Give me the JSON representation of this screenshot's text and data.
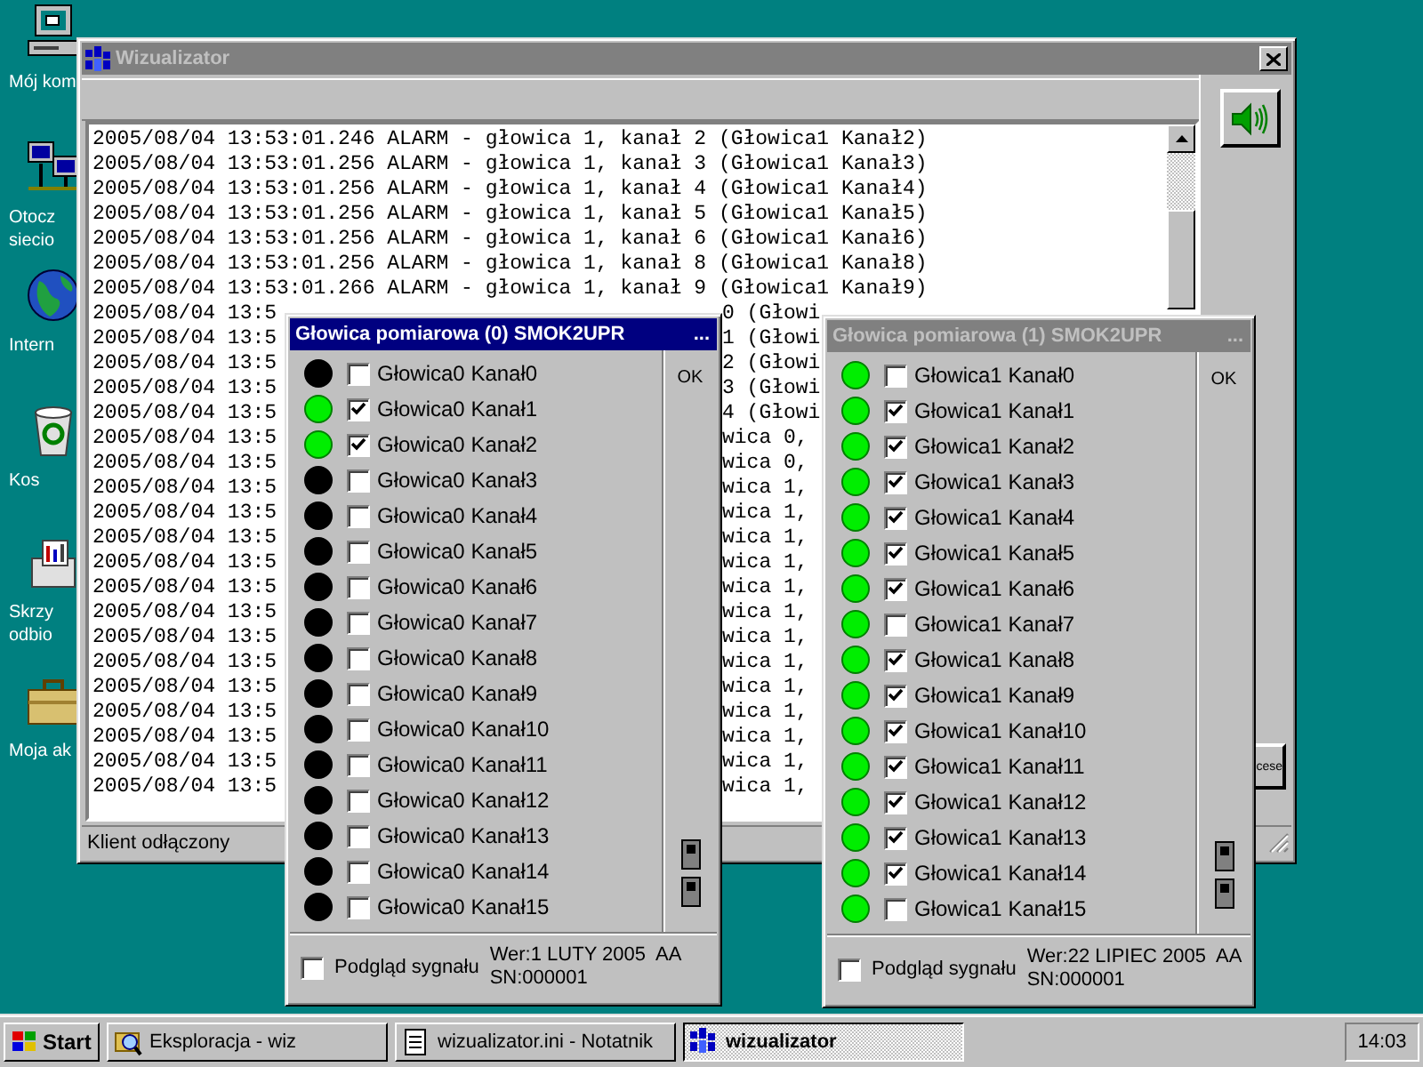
{
  "desktop_icons": [
    {
      "kind": "computer",
      "label_lines": [
        "Mój kom"
      ]
    },
    {
      "kind": "network",
      "label_lines": [
        "Otocz",
        "siecio"
      ]
    },
    {
      "kind": "globe",
      "label_lines": [
        "Intern"
      ]
    },
    {
      "kind": "recycle",
      "label_lines": [
        "Kos"
      ]
    },
    {
      "kind": "inbox",
      "label_lines": [
        "Skrzy",
        "odbio"
      ]
    },
    {
      "kind": "briefcase",
      "label_lines": [
        "Moja ak"
      ]
    }
  ],
  "main_window": {
    "title": "Wizualizator",
    "active": false,
    "log_lines": [
      {
        "text": "2005/08/04 13:53:01.246 ALARM - głowica 1, kanał 2 (Głowica1 Kanał2)"
      },
      {
        "text": "2005/08/04 13:53:01.256 ALARM - głowica 1, kanał 3 (Głowica1 Kanał3)"
      },
      {
        "text": "2005/08/04 13:53:01.256 ALARM - głowica 1, kanał 4 (Głowica1 Kanał4)"
      },
      {
        "text": "2005/08/04 13:53:01.256 ALARM - głowica 1, kanał 5 (Głowica1 Kanał5)"
      },
      {
        "text": "2005/08/04 13:53:01.256 ALARM - głowica 1, kanał 6 (Głowica1 Kanał6)"
      },
      {
        "text": "2005/08/04 13:53:01.256 ALARM - głowica 1, kanał 8 (Głowica1 Kanał8)"
      },
      {
        "text": "2005/08/04 13:53:01.266 ALARM - głowica 1, kanał 9 (Głowica1 Kanał9)"
      },
      {
        "left": "2005/08/04 13:5",
        "middle": "0 (Głowi"
      },
      {
        "left": "2005/08/04 13:5",
        "middle": "1 (Głowi"
      },
      {
        "left": "2005/08/04 13:5",
        "middle": "2 (Głowi"
      },
      {
        "left": "2005/08/04 13:5",
        "middle": "3 (Głowi"
      },
      {
        "left": "2005/08/04 13:5",
        "middle": "4 (Głowi"
      },
      {
        "left": "2005/08/04 13:5",
        "middle": "wica 0,"
      },
      {
        "left": "2005/08/04 13:5",
        "middle": "wica 0,"
      },
      {
        "left": "2005/08/04 13:5",
        "middle": "wica 1,"
      },
      {
        "left": "2005/08/04 13:5",
        "middle": "wica 1,"
      },
      {
        "left": "2005/08/04 13:5",
        "middle": "wica 1,"
      },
      {
        "left": "2005/08/04 13:5",
        "middle": "wica 1,"
      },
      {
        "left": "2005/08/04 13:5",
        "middle": "wica 1,"
      },
      {
        "left": "2005/08/04 13:5",
        "middle": "wica 1,"
      },
      {
        "left": "2005/08/04 13:5",
        "middle": "wica 1,"
      },
      {
        "left": "2005/08/04 13:5",
        "middle": "wica 1,"
      },
      {
        "left": "2005/08/04 13:5",
        "middle": "wica 1,"
      },
      {
        "left": "2005/08/04 13:5",
        "middle": "wica 1,"
      },
      {
        "left": "2005/08/04 13:5",
        "middle": "wica 1,"
      },
      {
        "left": "2005/08/04 13:5",
        "middle": "wica 1,"
      },
      {
        "left": "2005/08/04 13:5",
        "middle": "wica 1,"
      }
    ],
    "side_buttons": [
      {
        "kind": "speaker"
      },
      {
        "kind": "text",
        "label": "cese"
      }
    ],
    "status": "Klient odłączony"
  },
  "panels": [
    {
      "title": "Głowica pomiarowa (0) SMOK2UPR",
      "title_more": "...",
      "active": true,
      "ok_label": "OK",
      "channels": [
        {
          "label": "Głowica0 Kanał0",
          "on": false,
          "checked": false
        },
        {
          "label": "Głowica0 Kanał1",
          "on": true,
          "checked": true
        },
        {
          "label": "Głowica0 Kanał2",
          "on": true,
          "checked": true
        },
        {
          "label": "Głowica0 Kanał3",
          "on": false,
          "checked": false
        },
        {
          "label": "Głowica0 Kanał4",
          "on": false,
          "checked": false
        },
        {
          "label": "Głowica0 Kanał5",
          "on": false,
          "checked": false
        },
        {
          "label": "Głowica0 Kanał6",
          "on": false,
          "checked": false
        },
        {
          "label": "Głowica0 Kanał7",
          "on": false,
          "checked": false
        },
        {
          "label": "Głowica0 Kanał8",
          "on": false,
          "checked": false
        },
        {
          "label": "Głowica0 Kanał9",
          "on": false,
          "checked": false
        },
        {
          "label": "Głowica0 Kanał10",
          "on": false,
          "checked": false
        },
        {
          "label": "Głowica0 Kanał11",
          "on": false,
          "checked": false
        },
        {
          "label": "Głowica0 Kanał12",
          "on": false,
          "checked": false
        },
        {
          "label": "Głowica0 Kanał13",
          "on": false,
          "checked": false
        },
        {
          "label": "Głowica0 Kanał14",
          "on": false,
          "checked": false
        },
        {
          "label": "Głowica0 Kanał15",
          "on": false,
          "checked": false
        }
      ],
      "preview": {
        "label": "Podgląd sygnału",
        "checked": false
      },
      "version": "Wer:1 LUTY 2005  AA",
      "serial": "SN:000001"
    },
    {
      "title": "Głowica pomiarowa (1) SMOK2UPR",
      "title_more": "...",
      "active": false,
      "ok_label": "OK",
      "channels": [
        {
          "label": "Głowica1 Kanał0",
          "on": true,
          "checked": false
        },
        {
          "label": "Głowica1 Kanał1",
          "on": true,
          "checked": true
        },
        {
          "label": "Głowica1 Kanał2",
          "on": true,
          "checked": true
        },
        {
          "label": "Głowica1 Kanał3",
          "on": true,
          "checked": true
        },
        {
          "label": "Głowica1 Kanał4",
          "on": true,
          "checked": true
        },
        {
          "label": "Głowica1 Kanał5",
          "on": true,
          "checked": true
        },
        {
          "label": "Głowica1 Kanał6",
          "on": true,
          "checked": true
        },
        {
          "label": "Głowica1 Kanał7",
          "on": true,
          "checked": false
        },
        {
          "label": "Głowica1 Kanał8",
          "on": true,
          "checked": true
        },
        {
          "label": "Głowica1 Kanał9",
          "on": true,
          "checked": true
        },
        {
          "label": "Głowica1 Kanał10",
          "on": true,
          "checked": true
        },
        {
          "label": "Głowica1 Kanał11",
          "on": true,
          "checked": true
        },
        {
          "label": "Głowica1 Kanał12",
          "on": true,
          "checked": true
        },
        {
          "label": "Głowica1 Kanał13",
          "on": true,
          "checked": true
        },
        {
          "label": "Głowica1 Kanał14",
          "on": true,
          "checked": true
        },
        {
          "label": "Głowica1 Kanał15",
          "on": true,
          "checked": false
        }
      ],
      "preview": {
        "label": "Podgląd sygnału",
        "checked": false
      },
      "version": "Wer:22 LIPIEC 2005  AA",
      "serial": "SN:000001"
    }
  ],
  "taskbar": {
    "start": "Start",
    "tasks": [
      {
        "kind": "explorer",
        "label": "Eksploracja - wiz",
        "selected": false
      },
      {
        "kind": "notepad",
        "label": "wizualizator.ini - Notatnik",
        "selected": false
      },
      {
        "kind": "app",
        "label": "wizualizator",
        "selected": true
      }
    ],
    "clock": "14:03"
  }
}
